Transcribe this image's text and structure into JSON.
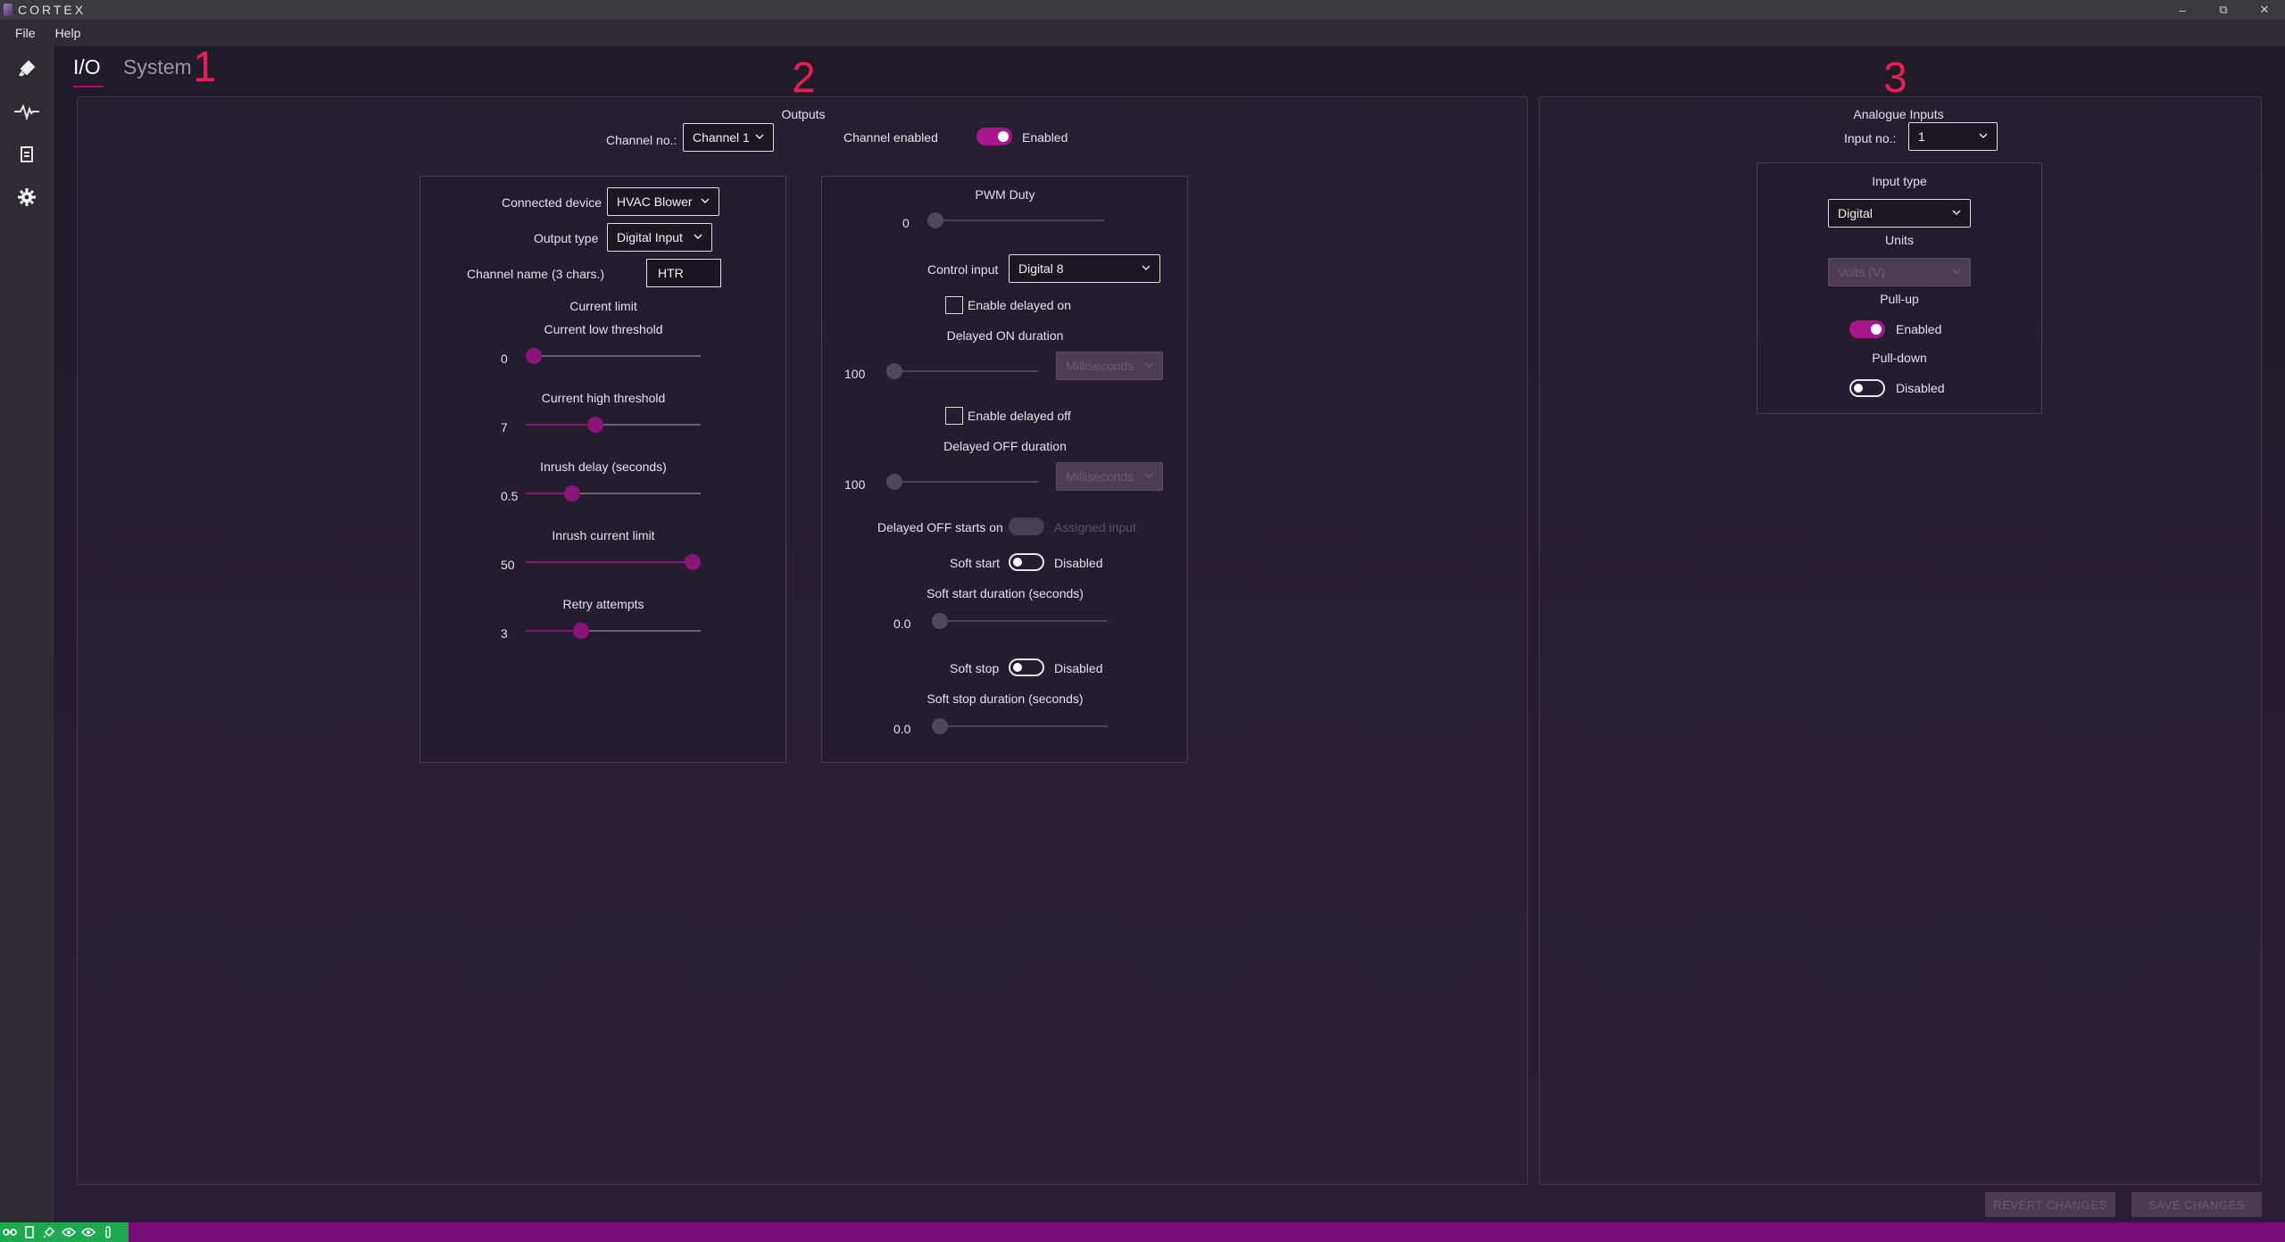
{
  "window": {
    "title": "CORTEX",
    "minimize": "–",
    "maximize": "⧉",
    "close": "✕"
  },
  "menu": {
    "file": "File",
    "help": "Help"
  },
  "tabs": {
    "io": "I/O",
    "system": "System"
  },
  "annotations": {
    "a1": "1",
    "a2": "2",
    "a3": "3"
  },
  "sidebar": {
    "icons": [
      "plug-icon",
      "waveform-icon",
      "document-icon",
      "gear-icon"
    ]
  },
  "outputs": {
    "title": "Outputs",
    "channel_no_label": "Channel no.:",
    "channel_no_value": "Channel 1",
    "channel_enabled_label": "Channel enabled",
    "channel_enabled_state": "Enabled",
    "connected_device_label": "Connected device",
    "connected_device_value": "HVAC Blower",
    "output_type_label": "Output type",
    "output_type_value": "Digital Input",
    "channel_name_label": "Channel name (3 chars.)",
    "channel_name_value": "HTR",
    "current_limit_label": "Current limit",
    "current_low_label": "Current low threshold",
    "current_low_value": "0",
    "current_low_level": 0.0,
    "current_high_label": "Current high threshold",
    "current_high_value": "7",
    "current_high_level": 0.39,
    "inrush_delay_label": "Inrush delay (seconds)",
    "inrush_delay_value": "0.5",
    "inrush_delay_level": 0.24,
    "inrush_limit_label": "Inrush current limit",
    "inrush_limit_value": "50",
    "inrush_limit_level": 1.0,
    "retry_label": "Retry attempts",
    "retry_value": "3",
    "retry_level": 0.3,
    "pwm_duty_label": "PWM Duty",
    "pwm_duty_value": "0",
    "pwm_duty_level": 0.0,
    "control_input_label": "Control input",
    "control_input_value": "Digital 8",
    "enable_delayed_on_label": "Enable delayed on",
    "delayed_on_duration_label": "Delayed ON duration",
    "delayed_on_value": "100",
    "delayed_on_units": "Milliseconds",
    "enable_delayed_off_label": "Enable delayed off",
    "delayed_off_duration_label": "Delayed OFF duration",
    "delayed_off_value": "100",
    "delayed_off_units": "Milliseconds",
    "delayed_off_starts_label": "Delayed OFF starts on",
    "delayed_off_starts_state": "Assigned input",
    "soft_start_label": "Soft start",
    "soft_start_state": "Disabled",
    "soft_start_duration_label": "Soft start duration (seconds)",
    "soft_start_duration_value": "0.0",
    "soft_stop_label": "Soft stop",
    "soft_stop_state": "Disabled",
    "soft_stop_duration_label": "Soft stop duration (seconds)",
    "soft_stop_duration_value": "0.0"
  },
  "analogue": {
    "title": "Analogue Inputs",
    "input_no_label": "Input no.:",
    "input_no_value": "1",
    "input_type_label": "Input type",
    "input_type_value": "Digital",
    "units_label": "Units",
    "units_value": "Volts (V)",
    "pullup_label": "Pull-up",
    "pullup_state": "Enabled",
    "pulldown_label": "Pull-down",
    "pulldown_state": "Disabled"
  },
  "buttons": {
    "revert": "REVERT CHANGES",
    "save": "SAVE CHANGES"
  },
  "colors": {
    "accent": "#a8158c",
    "annotation": "#e81e54",
    "status_bar": "#7a0c78",
    "status_ok": "#1ea84f"
  }
}
